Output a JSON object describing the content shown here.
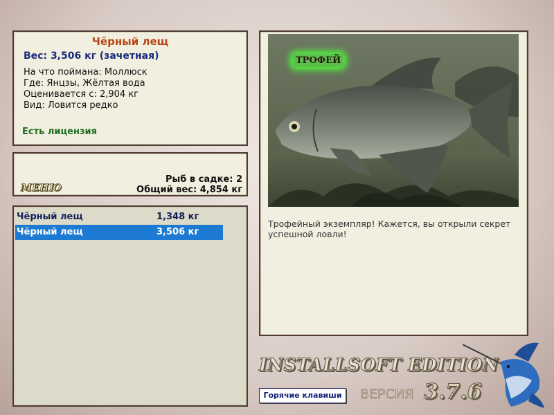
{
  "info": {
    "title": "Чёрный лещ",
    "weight": "Вес: 3,506 кг (зачетная)",
    "bait": "На что поймана: Моллюск",
    "where": "Где: Янцзы, Жёлтая вода",
    "value": "Оценивается с: 2,904 кг",
    "kind": "Вид: Ловится редко",
    "license": "Есть лицензия"
  },
  "status": {
    "menu_label": "МЕНЮ",
    "fish_count": "Рыб в садке: 2",
    "total_weight": "Общий вес: 4,854 кг"
  },
  "catch_list": [
    {
      "name": "Чёрный лещ",
      "weight": "1,348 кг",
      "selected": false
    },
    {
      "name": "Чёрный лещ",
      "weight": "3,506 кг",
      "selected": true
    }
  ],
  "photo": {
    "badge": "ТРОФЕЙ",
    "description": "Трофейный экземпляр! Кажется, вы открыли секрет успешной ловли!"
  },
  "footer": {
    "brand": "INSTALLSOFT EDITION",
    "hotkeys_label": "Горячие клавиши",
    "version_label": "ВЕРСИЯ",
    "version_number": "3.7.6"
  },
  "colors": {
    "title": "#b5461a",
    "weight": "#1a2a7a",
    "license": "#1e6e1e",
    "selection": "#1c7ad3",
    "panel": "#f1efdf"
  },
  "icons": [
    "trophy-badge",
    "marlin-logo",
    "fish-photo"
  ]
}
